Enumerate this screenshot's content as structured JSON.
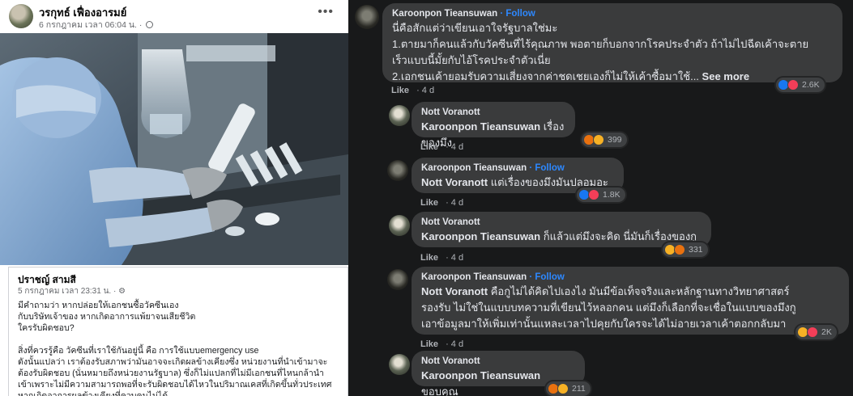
{
  "left_post": {
    "author": "วรกุทธ์ เฟื่องอารมย์",
    "time": "6 กรกฎาคม เวลา 06:04 น. ·",
    "more_icon": "more-dots-icon"
  },
  "quoted_post": {
    "author": "ปราชญ์ สามสี",
    "time": "5 กรกฎาคม เวลา 23:31 น. · ⚙",
    "body": "มีคำถามว่า หากปล่อยให้เอกชนซื้อวัคซีนเอง\nกับบริษัทเจ้าของ หากเกิดอาการแพ้ยาจนเสียชีวิต\nใครรับผิดชอบ?\n\nสิ่งที่ควรรู้คือ  วัคซีนที่เราใช้กันอยู่นี้ คือ การใช้แบบemergency use\nดังนั้นแปลว่า เราต้องรับสภาพว่ามันอาจจะเกิดผลข้างเคียงซึ่ง หน่วยงานที่นำเข้ามาจะ\nต้องรับผิดชอบ (นั่นหมายถึงหน่วยงานรัฐบาล) ซึ่งก็ไม่แปลกที่ไม่มีเอกชนที่ไหนกล้านำ\nเข้าเพราะไม่มีความสามารถพอที่จะรับผิดชอบได้ไหวในปริมาณเคสที่เกิดขึ้นทั่วประเทศ\nหากเกิดอาการผลข้างเคียงที่ควบคุมไม่ได้"
  },
  "comments": [
    {
      "author": "Karoonpon Tieansuwan",
      "follow": "Follow",
      "text": "นี่คือสักแต่ว่าเขียนเอาใจรัฐบาลใช่มะ\n1.ตายมาก็คนแล้วกับวัคซีนที่ไร้คุณภาพ พอตายก็บอกจากโรคประจำตัว ถ้าไม่ไปฉีดเค้าจะตาย\nเร็วแบบนี้มั้ยกับไอ้โรคประจำตัวเนี่ย\n2.เอกชนเค้ายอมรับความเสี่ยงจากค่าชดเชยเองก็ไม่ให้เค้าซื้อมาใช้... ",
      "see_more": "See more",
      "like": "Like",
      "time": "4 d",
      "reactions": "2.6K"
    },
    {
      "author": "Nott Voranott",
      "tag": "Karoonpon Tieansuwan",
      "text": " เรื่องของมึง",
      "like": "Like",
      "time": "4 d",
      "reactions": "399"
    },
    {
      "author": "Karoonpon Tieansuwan",
      "follow": "Follow",
      "tag": "Nott Voranott",
      "text": " แต่เรื่องของมึงมันปลอมอะ",
      "like": "Like",
      "time": "4 d",
      "reactions": "1.8K"
    },
    {
      "author": "Nott Voranott",
      "tag": "Karoonpon Tieansuwan",
      "text": " ก็แล้วแต่มึงจะคิด นี่มันก็เรื่องของกู",
      "like": "Like",
      "time": "4 d",
      "reactions": "331"
    },
    {
      "author": "Karoonpon Tieansuwan",
      "follow": "Follow",
      "tag": "Nott Voranott",
      "text": " คือกูไม่ได้คิดไปเองไง มันมีข้อเท็จจริงและหลักฐานทางวิทยาศาสตร์\nรองรับ ไม่ใช่ในแบบบทความที่เขียนไว้หลอกคน แต่มึงก็เลือกที่จะเชื่อในแบบของมึงกู\nเอาข้อมูลมาให้เพิ่มเท่านั้นแหละเวลาไปคุยกับใครจะได้ไม่อายเวลาเค้าตอกกลับมา",
      "like": "Like",
      "time": "4 d",
      "reactions": "2K"
    },
    {
      "author": "Nott Voranott",
      "tag": "Karoonpon Tieansuwan",
      "text": " ขอบคุณ",
      "like": "Like",
      "time": "4 d",
      "reactions": "211"
    }
  ]
}
